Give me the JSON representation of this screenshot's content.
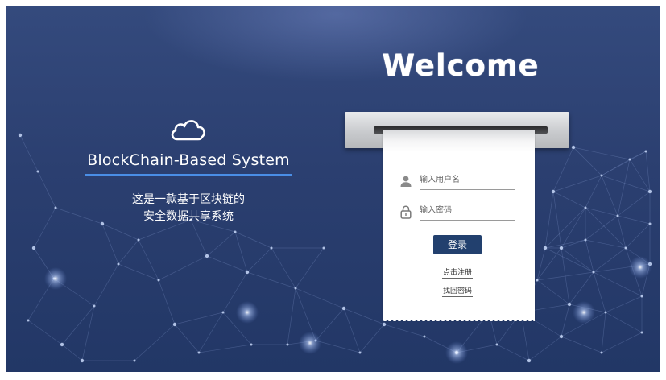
{
  "branding": {
    "title": "BlockChain-Based System",
    "tagline_line1": "这是一款基于区块链的",
    "tagline_line2": "安全数据共享系统",
    "logo_icon": "cloud-icon"
  },
  "welcome": "Welcome",
  "login_form": {
    "username_placeholder": "输入用户名",
    "password_placeholder": "输入密码",
    "username_icon": "user-icon",
    "password_icon": "lock-icon",
    "login_button": "登录",
    "register_link": "点击注册",
    "forgot_password_link": "找回密码"
  },
  "colors": {
    "background": "#2b3f70",
    "accent_line": "#4a8ee6",
    "button": "#22406e"
  }
}
